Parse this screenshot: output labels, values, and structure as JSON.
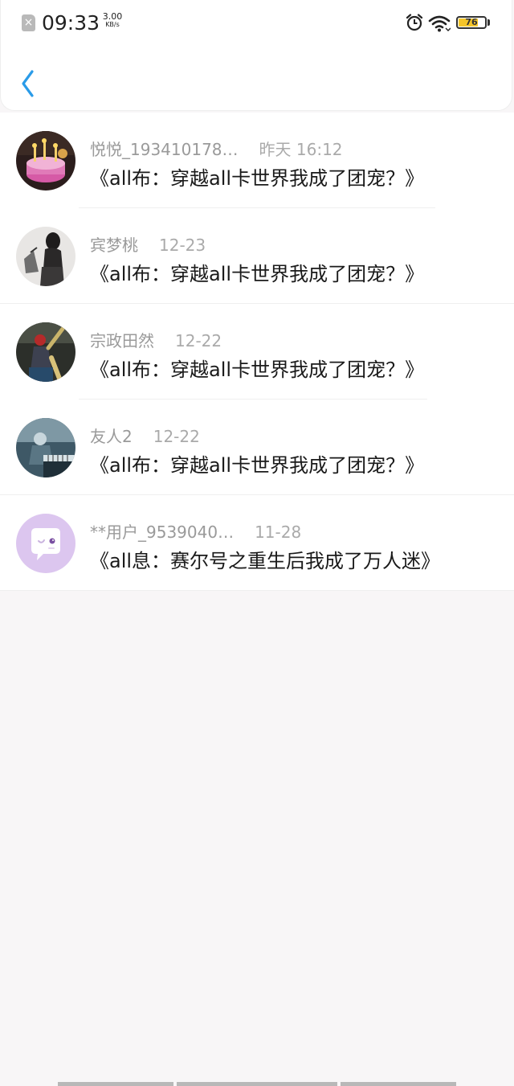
{
  "status_bar": {
    "time": "09:33",
    "speed_value": "3.00",
    "speed_unit": "KB/s",
    "battery": "76",
    "battery_level": 0.76
  },
  "header": {
    "back_icon": "chevron-left-icon",
    "accent_color": "#2a9be8"
  },
  "comments": [
    {
      "user": "悦悦_193410178…",
      "time": "昨天 16:12",
      "book": "《all布：穿越all卡世界我成了团宠？》",
      "avatar": "cake-photo"
    },
    {
      "user": "宾梦桃",
      "time": "12-23",
      "book": "《all布：穿越all卡世界我成了团宠？》",
      "avatar": "person-photo"
    },
    {
      "user": "宗政田然",
      "time": "12-22",
      "book": "《all布：穿越all卡世界我成了团宠？》",
      "avatar": "dancer-photo"
    },
    {
      "user": "友人2",
      "time": "12-22",
      "book": "《all布：穿越all卡世界我成了团宠？》",
      "avatar": "piano-photo"
    },
    {
      "user": "**用户_9539040…",
      "time": "11-28",
      "book": "《all息：赛尔号之重生后我成了万人迷》",
      "avatar": "default-chat-avatar"
    }
  ]
}
